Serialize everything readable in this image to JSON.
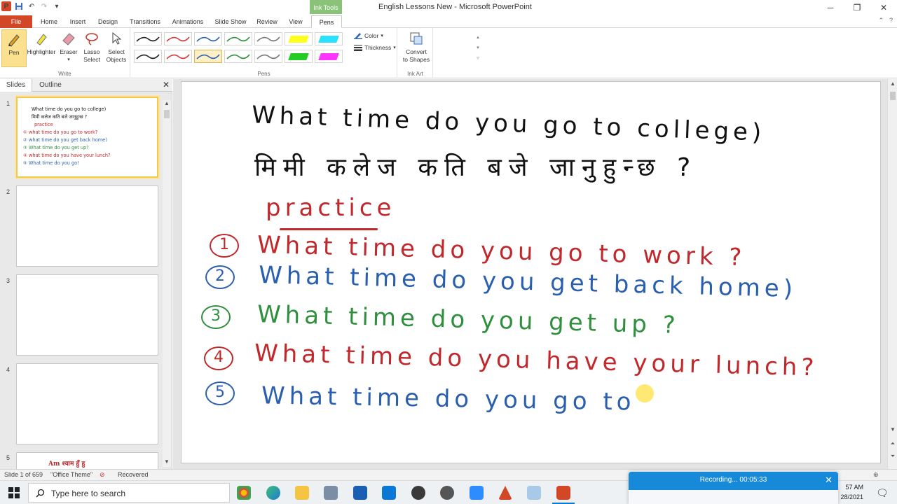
{
  "window": {
    "title": "English Lessons New - Microsoft PowerPoint",
    "contextual_tab_group": "Ink Tools",
    "controls": {
      "minimize": "─",
      "maximize": "❐",
      "close": "✕"
    }
  },
  "tabs": [
    {
      "label": "File"
    },
    {
      "label": "Home"
    },
    {
      "label": "Insert"
    },
    {
      "label": "Design"
    },
    {
      "label": "Transitions"
    },
    {
      "label": "Animations"
    },
    {
      "label": "Slide Show"
    },
    {
      "label": "Review"
    },
    {
      "label": "View"
    },
    {
      "label": "Pens"
    }
  ],
  "ribbon": {
    "write": {
      "label": "Write",
      "pen": "Pen",
      "highlighter": "Highlighter",
      "eraser": "Eraser",
      "lasso_1": "Lasso",
      "lasso_2": "Select",
      "select_1": "Select",
      "select_2": "Objects"
    },
    "pens": {
      "label": "Pens",
      "color": "Color",
      "thickness": "Thickness"
    },
    "ink_art": {
      "label": "Ink Art",
      "convert_1": "Convert",
      "convert_2": "to Shapes"
    }
  },
  "pen_colors": [
    "#222222",
    "#d33b3b",
    "#2a62b5",
    "#2f8f3e",
    "#777777",
    "#ffff1a",
    "#29e0ff",
    "#222222",
    "#d33b3b",
    "#2a62b5",
    "#2f8f3e",
    "#777777",
    "#22cc22",
    "#ff33ff"
  ],
  "left_panel": {
    "tab_slides": "Slides",
    "tab_outline": "Outline",
    "close": "✕",
    "thumbs": [
      {
        "num": "1"
      },
      {
        "num": "2"
      },
      {
        "num": "3"
      },
      {
        "num": "4"
      },
      {
        "num": "5",
        "text": "Am  श्याम हुँ हु"
      }
    ],
    "thumb1_lines": [
      "What time do you go to college)",
      "मिमी कलेज कति बजे जानुहुन्छ ?",
      "practice",
      "① what time do you go to work?",
      "② what time do you get back home)",
      "③ What time do you get up?",
      "④ what time do you have your lunch?",
      "⑤ What time do you go!"
    ]
  },
  "slide": {
    "line1": "What time do you go to college)",
    "line2": "मिमी कलेज कति बजे जानुहुन्छ ?",
    "heading": "practice",
    "items": [
      {
        "num": "1",
        "text": "What time do you go to work ?"
      },
      {
        "num": "2",
        "text": "What time do you get back home)"
      },
      {
        "num": "3",
        "text": "What time do you get up ?"
      },
      {
        "num": "4",
        "text": "What time do you have your lunch?"
      },
      {
        "num": "5",
        "text": "What time do you go to"
      }
    ]
  },
  "status": {
    "slide_info": "Slide 1 of 659",
    "theme": "\"Office Theme\"",
    "recovered": "Recovered"
  },
  "taskbar": {
    "search_placeholder": "Type here to search",
    "time": "57 AM",
    "date": "28/2021"
  },
  "recording": {
    "text": "Recording...  00:05:33",
    "close": "✕"
  }
}
